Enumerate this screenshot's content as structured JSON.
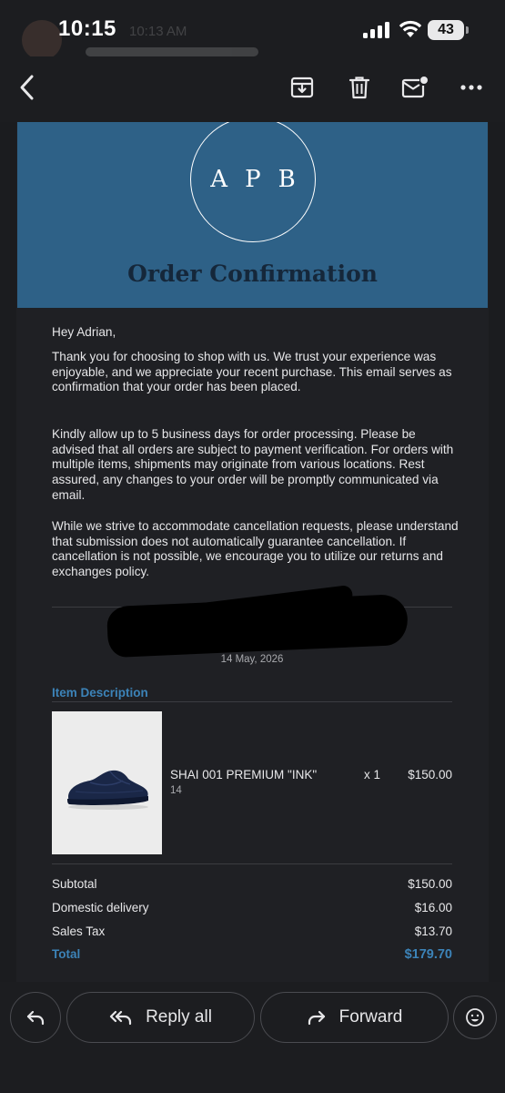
{
  "status_bar": {
    "time": "10:15",
    "battery": "43",
    "faded_sender_time": "10:13 AM"
  },
  "toolbar": {
    "icons": [
      "back-icon",
      "archive-icon",
      "trash-icon",
      "mark-unread-icon",
      "more-icon"
    ]
  },
  "email": {
    "logo_text": "APB",
    "title": "Order Confirmation",
    "greeting": "Hey Adrian,",
    "paragraphs": [
      "Thank you for choosing to shop with us. We trust your experience was enjoyable, and we appreciate your recent purchase. This email serves as confirmation that your order has been placed.",
      "Kindly allow up to 5 business days for order processing. Please be advised that all orders are subject to payment verification. For orders with multiple items, shipments may originate from various locations. Rest assured, any changes to your order will be promptly communicated via email.",
      "While we strive to accommodate cancellation requests, please understand that submission does not automatically guarantee cancellation. If cancellation is not possible, we encourage you to utilize our returns and exchanges policy."
    ],
    "order_date": "14 May, 2026",
    "items_header": "Item Description",
    "item": {
      "name": "SHAI 001 PREMIUM \"INK\"",
      "size": "14",
      "quantity": "x 1",
      "price": "$150.00"
    },
    "summary": {
      "subtotal_label": "Subtotal",
      "subtotal": "$150.00",
      "delivery_label": "Domestic delivery",
      "delivery": "$16.00",
      "tax_label": "Sales Tax",
      "tax": "$13.70",
      "total_label": "Total",
      "total": "$179.70"
    }
  },
  "actions": {
    "reply_all": "Reply all",
    "forward": "Forward"
  },
  "colors": {
    "hero_blue": "#2e6187",
    "accent_blue": "#3c83b8",
    "background": "#1f2024"
  }
}
